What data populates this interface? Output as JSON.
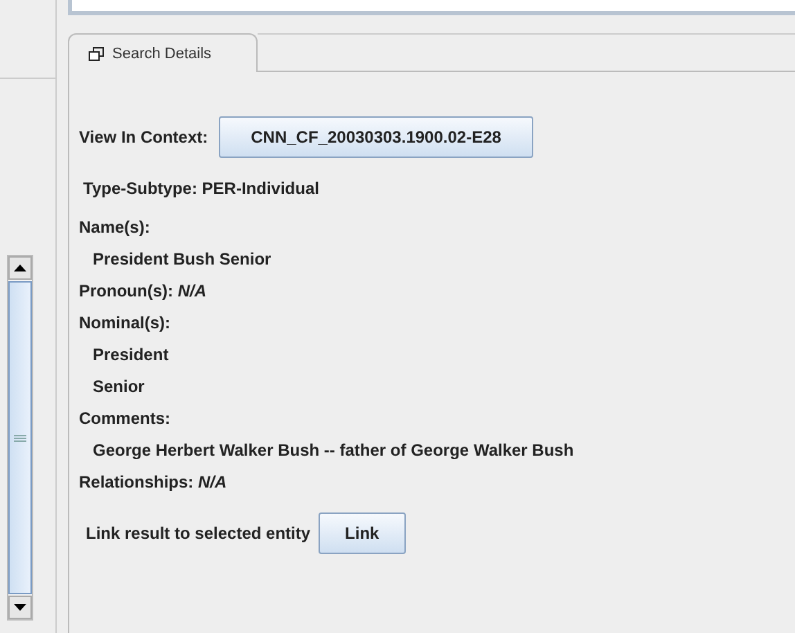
{
  "tabs": [
    {
      "label": "Search Details",
      "selected": true
    }
  ],
  "view_in_context": {
    "label": "View In Context:",
    "button": "CNN_CF_20030303.1900.02-E28"
  },
  "type_subtype": "Type-Subtype: PER-Individual",
  "lines": [
    {
      "kind": "heading",
      "text": "Name(s):"
    },
    {
      "kind": "value",
      "text": "President Bush Senior"
    },
    {
      "kind": "heading",
      "text": "Pronoun(s): *N/A*"
    },
    {
      "kind": "heading",
      "text": "Nominal(s):"
    },
    {
      "kind": "value",
      "text": "President"
    },
    {
      "kind": "value",
      "text": "Senior"
    },
    {
      "kind": "heading",
      "text": "Comments:"
    },
    {
      "kind": "value",
      "text": "George Herbert Walker Bush -- father of George Walker Bush"
    },
    {
      "kind": "heading",
      "text": "Relationships: *N/A*"
    }
  ],
  "link": {
    "label": "Link result to selected entity",
    "button": "Link"
  }
}
